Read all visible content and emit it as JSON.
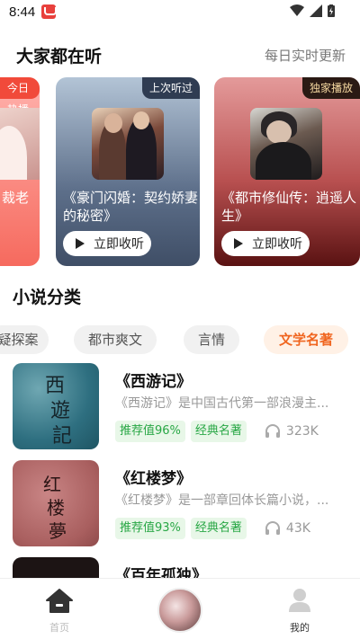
{
  "status_bar": {
    "time": "8:44"
  },
  "hot_section": {
    "title": "大家都在听",
    "subtitle": "每日实时更新"
  },
  "carousel": [
    {
      "badge": "今日热播",
      "title": "裁老",
      "button": "立即收听"
    },
    {
      "badge": "上次听过",
      "title": "《豪门闪婚：契约娇妻的秘密》",
      "button": "立即收听"
    },
    {
      "badge": "独家播放",
      "title": "《都市修仙传：逍遥人生》",
      "button": "立即收听"
    }
  ],
  "category": {
    "title": "小说分类",
    "tags": [
      {
        "label": "疑探案",
        "active": false
      },
      {
        "label": "都市爽文",
        "active": false
      },
      {
        "label": "言情",
        "active": false
      },
      {
        "label": "文学名著",
        "active": true
      }
    ]
  },
  "books": [
    {
      "title": "《西游记》",
      "desc": "《西游记》是中国古代第一部浪漫主...",
      "tags": [
        "推荐值96%",
        "经典名著"
      ],
      "listens": "323K",
      "cover_chars": [
        "西",
        "遊",
        "記"
      ]
    },
    {
      "title": "《红楼梦》",
      "desc": "《红楼梦》是一部章回体长篇小说，...",
      "tags": [
        "推荐值93%",
        "经典名著"
      ],
      "listens": "43K",
      "cover_chars": [
        "红",
        "楼",
        "夢"
      ]
    },
    {
      "title": "《百年孤独》",
      "desc": "",
      "tags": [],
      "listens": ""
    }
  ],
  "bottom_nav": {
    "home": "首页",
    "mine": "我的"
  },
  "colors": {
    "accent": "#f0651f",
    "tag_green": "#28a745",
    "hot_red": "#f14a3a"
  }
}
